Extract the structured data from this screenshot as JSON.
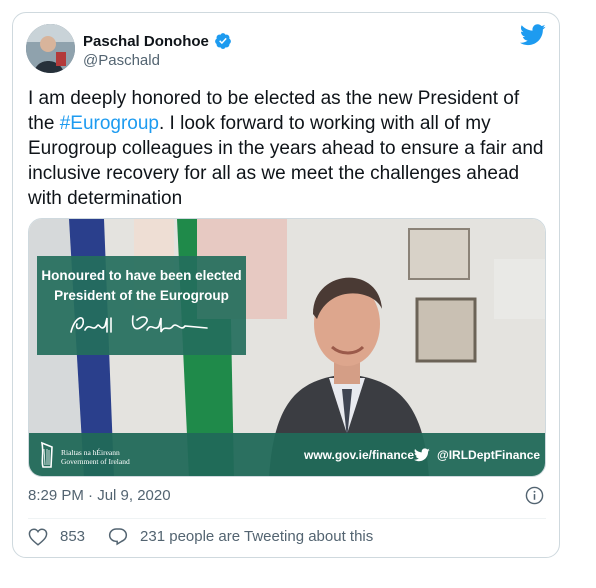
{
  "tweet": {
    "author_name": "Paschal Donohoe",
    "author_handle": "@Paschald",
    "text_before_hashtag": "I am deeply honored to be elected as the new President of the ",
    "hashtag": "#Eurogroup",
    "text_after_hashtag": ". I look forward to working with all of my Eurogroup colleagues in the years ahead to ensure a fair and inclusive recovery for all as we meet the challenges ahead with determination",
    "timestamp": "8:29 PM · Jul 9, 2020",
    "likes": "853",
    "conversation_text": "231 people are Tweeting about this"
  },
  "media": {
    "overlay_line1": "Honoured to have been elected",
    "overlay_line2": "President of the Eurogroup",
    "gov_line1": "Rialtas na hÉireann",
    "gov_line2": "Government of Ireland",
    "website": "www.gov.ie/finance",
    "dept_handle": "@IRLDeptFinance"
  },
  "colors": {
    "twitter_blue": "#1d9bf0",
    "overlay_green": "#246e5c",
    "text_secondary": "#536471"
  },
  "icons": [
    "verified-badge-icon",
    "twitter-bird-icon",
    "info-icon",
    "heart-icon",
    "reply-bubble-icon"
  ]
}
